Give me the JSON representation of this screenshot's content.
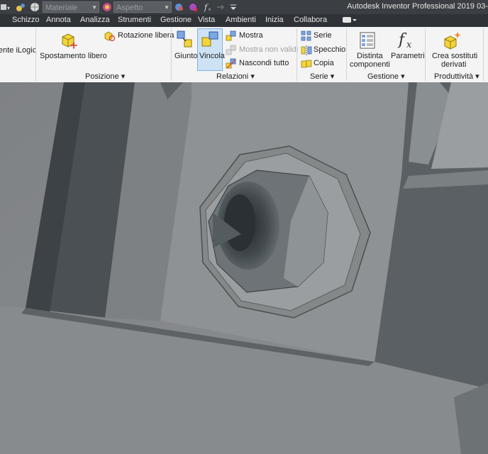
{
  "title_bar": {
    "material_combo": "Materiale",
    "appearance_combo": "Aspetto",
    "app_title": "Autodesk Inventor Professional 2019   03-"
  },
  "menu": {
    "items": [
      "Schizzo",
      "Annota",
      "Analizza",
      "Strumenti",
      "Gestione",
      "Vista",
      "Ambienti",
      "Inizia",
      "Collabora"
    ]
  },
  "ribbon": {
    "ilogic_label": "ente iLogic",
    "posizione": {
      "free_move": "Spostamento libero",
      "free_rotate": "Rotazione libera",
      "footer": "Posizione"
    },
    "relazioni": {
      "joint": "Giunto",
      "constrain": "Vincola",
      "show": "Mostra",
      "show_invalid": "Mostra non validi",
      "hide_all": "Nascondi tutto",
      "footer": "Relazioni"
    },
    "serie": {
      "pattern": "Serie",
      "mirror": "Specchio",
      "copy": "Copia",
      "footer": "Serie"
    },
    "gestione": {
      "bom_line1": "Distinta",
      "bom_line2": "componenti",
      "parameters": "Parametri",
      "footer": "Gestione"
    },
    "produttivita": {
      "create_sub_line1": "Crea sostituti",
      "create_sub_line2": "derivati",
      "footer": "Produttività"
    }
  },
  "colors": {
    "active_highlight": "#cde3f5",
    "ribbon_bg": "#f4f4f4",
    "title_bg": "#3b3e42"
  }
}
